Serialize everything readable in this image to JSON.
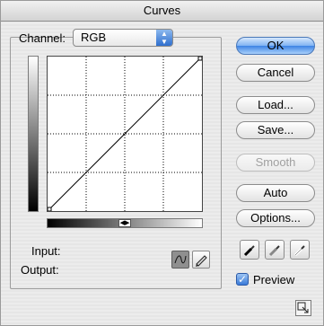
{
  "window": {
    "title": "Curves"
  },
  "channel": {
    "label": "Channel:",
    "value": "RGB"
  },
  "readouts": {
    "input_label": "Input:",
    "output_label": "Output:"
  },
  "buttons": {
    "ok": "OK",
    "cancel": "Cancel",
    "load": "Load...",
    "save": "Save...",
    "smooth": "Smooth",
    "auto": "Auto",
    "options": "Options..."
  },
  "preview": {
    "label": "Preview",
    "checked": true
  },
  "icons": {
    "curve_tool": "curve-tool-icon",
    "pencil_tool": "pencil-tool-icon",
    "black_eyedropper": "black-eyedropper-icon",
    "gray_eyedropper": "gray-eyedropper-icon",
    "white_eyedropper": "white-eyedropper-icon",
    "resize": "expand-icon"
  },
  "colors": {
    "accent": "#3d83e4",
    "grid": "#000000"
  }
}
